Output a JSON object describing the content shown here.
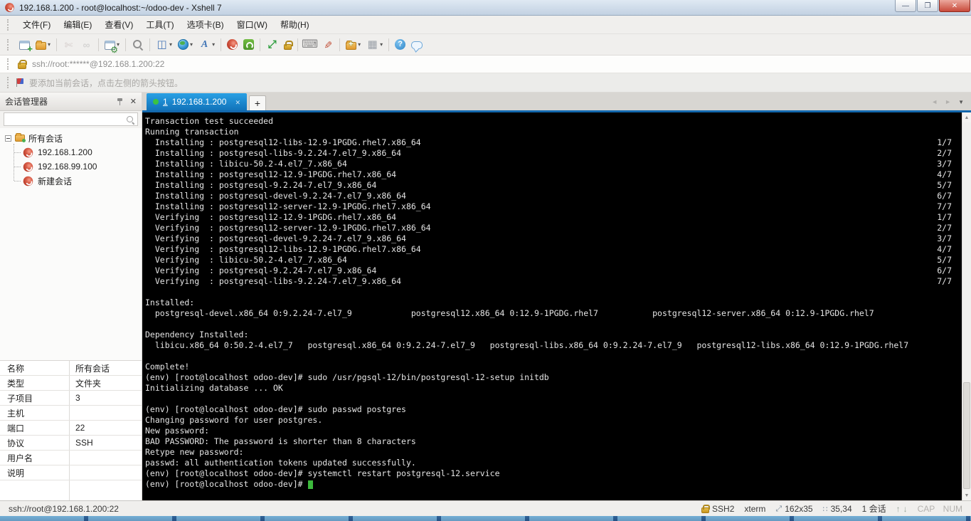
{
  "window": {
    "title": "192.168.1.200 - root@localhost:~/odoo-dev - Xshell 7",
    "accent_blue": "#1273ba",
    "terminal_bg": "#000000",
    "cursor_green": "#3cb93c"
  },
  "menu": {
    "items": [
      {
        "name": "menu-file",
        "label": "文件(F)"
      },
      {
        "name": "menu-edit",
        "label": "编辑(E)"
      },
      {
        "name": "menu-view",
        "label": "查看(V)"
      },
      {
        "name": "menu-tools",
        "label": "工具(T)"
      },
      {
        "name": "menu-tab",
        "label": "选项卡(B)"
      },
      {
        "name": "menu-window",
        "label": "窗口(W)"
      },
      {
        "name": "menu-help",
        "label": "帮助(H)"
      }
    ]
  },
  "toolbar": {
    "items": [
      {
        "name": "new-session-button",
        "icon": "new-session-icon",
        "type": "newwin"
      },
      {
        "name": "open-folder-button",
        "icon": "open-folder-icon",
        "type": "folder",
        "dropdown": true
      },
      {
        "sep": true
      },
      {
        "name": "disconnect-button",
        "icon": "disconnect-icon",
        "type": "scissors",
        "disabled": true
      },
      {
        "name": "reconnect-button",
        "icon": "chain-link-icon",
        "type": "chain",
        "disabled": true
      },
      {
        "sep": true
      },
      {
        "name": "session-properties-button",
        "icon": "gear-icon",
        "type": "gearwin",
        "dropdown": true
      },
      {
        "sep": true
      },
      {
        "name": "find-button",
        "icon": "search-icon",
        "type": "magnifier"
      },
      {
        "sep": true
      },
      {
        "name": "layout-button",
        "icon": "layout-icon",
        "type": "layout",
        "dropdown": true
      },
      {
        "name": "web-button",
        "icon": "globe-icon",
        "type": "globe",
        "dropdown": true
      },
      {
        "name": "font-button",
        "icon": "font-icon",
        "type": "fontA",
        "dropdown": true
      },
      {
        "sep": true
      },
      {
        "name": "xshell-button",
        "icon": "xshell-icon",
        "type": "xshell"
      },
      {
        "name": "xftp-button",
        "icon": "xftp-icon",
        "type": "xftp"
      },
      {
        "sep": true
      },
      {
        "name": "fullscreen-button",
        "icon": "fullscreen-icon",
        "type": "fullscreen"
      },
      {
        "name": "lock-button",
        "icon": "lock-icon",
        "type": "lock"
      },
      {
        "sep": true
      },
      {
        "name": "keyboard-button",
        "icon": "keyboard-icon",
        "type": "keyboard"
      },
      {
        "name": "compose-button",
        "icon": "pen-icon",
        "type": "pen"
      },
      {
        "sep": true
      },
      {
        "name": "new-folder-button",
        "icon": "folder-plus-icon",
        "type": "folderplus",
        "dropdown": true
      },
      {
        "name": "views-button",
        "icon": "grid-icon",
        "type": "grid",
        "dropdown": true
      },
      {
        "sep": true
      },
      {
        "name": "help-button",
        "icon": "help-icon",
        "type": "help"
      },
      {
        "name": "feedback-button",
        "icon": "speech-bubble-icon",
        "type": "bubble"
      }
    ]
  },
  "address_bar": {
    "value": "ssh://root:******@192.168.1.200:22"
  },
  "notice_bar": {
    "text": "要添加当前会话，点击左侧的箭头按钮。"
  },
  "session_manager": {
    "title": "会话管理器",
    "root_label": "所有会话",
    "sessions": [
      {
        "name": "session-item-192-168-1-200",
        "label": "192.168.1.200"
      },
      {
        "name": "session-item-192-168-99-100",
        "label": "192.168.99.100"
      },
      {
        "name": "session-item-new",
        "label": "新建会话"
      }
    ]
  },
  "properties": {
    "rows": [
      {
        "label": "名称",
        "value": "所有会话"
      },
      {
        "label": "类型",
        "value": "文件夹"
      },
      {
        "label": "子项目",
        "value": "3"
      },
      {
        "label": "主机",
        "value": ""
      },
      {
        "label": "端口",
        "value": "22"
      },
      {
        "label": "协议",
        "value": "SSH"
      },
      {
        "label": "用户名",
        "value": ""
      },
      {
        "label": "说明",
        "value": ""
      }
    ]
  },
  "tabs": {
    "active_index": "1",
    "active_label": "192.168.1.200"
  },
  "terminal": {
    "lines": [
      {
        "t": "Transaction test succeeded"
      },
      {
        "t": "Running transaction"
      },
      {
        "t": "  Installing : postgresql12-libs-12.9-1PGDG.rhel7.x86_64",
        "r": "1/7"
      },
      {
        "t": "  Installing : postgresql-libs-9.2.24-7.el7_9.x86_64",
        "r": "2/7"
      },
      {
        "t": "  Installing : libicu-50.2-4.el7_7.x86_64",
        "r": "3/7"
      },
      {
        "t": "  Installing : postgresql12-12.9-1PGDG.rhel7.x86_64",
        "r": "4/7"
      },
      {
        "t": "  Installing : postgresql-9.2.24-7.el7_9.x86_64",
        "r": "5/7"
      },
      {
        "t": "  Installing : postgresql-devel-9.2.24-7.el7_9.x86_64",
        "r": "6/7"
      },
      {
        "t": "  Installing : postgresql12-server-12.9-1PGDG.rhel7.x86_64",
        "r": "7/7"
      },
      {
        "t": "  Verifying  : postgresql12-12.9-1PGDG.rhel7.x86_64",
        "r": "1/7"
      },
      {
        "t": "  Verifying  : postgresql12-server-12.9-1PGDG.rhel7.x86_64",
        "r": "2/7"
      },
      {
        "t": "  Verifying  : postgresql-devel-9.2.24-7.el7_9.x86_64",
        "r": "3/7"
      },
      {
        "t": "  Verifying  : postgresql12-libs-12.9-1PGDG.rhel7.x86_64",
        "r": "4/7"
      },
      {
        "t": "  Verifying  : libicu-50.2-4.el7_7.x86_64",
        "r": "5/7"
      },
      {
        "t": "  Verifying  : postgresql-9.2.24-7.el7_9.x86_64",
        "r": "6/7"
      },
      {
        "t": "  Verifying  : postgresql-libs-9.2.24-7.el7_9.x86_64",
        "r": "7/7"
      },
      {
        "t": ""
      },
      {
        "t": "Installed:"
      },
      {
        "t": "  postgresql-devel.x86_64 0:9.2.24-7.el7_9            postgresql12.x86_64 0:12.9-1PGDG.rhel7           postgresql12-server.x86_64 0:12.9-1PGDG.rhel7"
      },
      {
        "t": ""
      },
      {
        "t": "Dependency Installed:"
      },
      {
        "t": "  libicu.x86_64 0:50.2-4.el7_7   postgresql.x86_64 0:9.2.24-7.el7_9   postgresql-libs.x86_64 0:9.2.24-7.el7_9   postgresql12-libs.x86_64 0:12.9-1PGDG.rhel7"
      },
      {
        "t": ""
      },
      {
        "t": "Complete!"
      },
      {
        "t": "(env) [root@localhost odoo-dev]# sudo /usr/pgsql-12/bin/postgresql-12-setup initdb"
      },
      {
        "t": "Initializing database ... OK"
      },
      {
        "t": ""
      },
      {
        "t": "(env) [root@localhost odoo-dev]# sudo passwd postgres"
      },
      {
        "t": "Changing password for user postgres."
      },
      {
        "t": "New password:"
      },
      {
        "t": "BAD PASSWORD: The password is shorter than 8 characters"
      },
      {
        "t": "Retype new password:"
      },
      {
        "t": "passwd: all authentication tokens updated successfully."
      },
      {
        "t": "(env) [root@localhost odoo-dev]# systemctl restart postgresql-12.service"
      },
      {
        "t": "(env) [root@localhost odoo-dev]# ",
        "cursor": true
      }
    ]
  },
  "status_bar": {
    "left": "ssh://root@192.168.1.200:22",
    "protocol": "SSH2",
    "term": "xterm",
    "size": "162x35",
    "cursor": "35,34",
    "sessions": "1 会话",
    "cap": "CAP",
    "num": "NUM"
  }
}
